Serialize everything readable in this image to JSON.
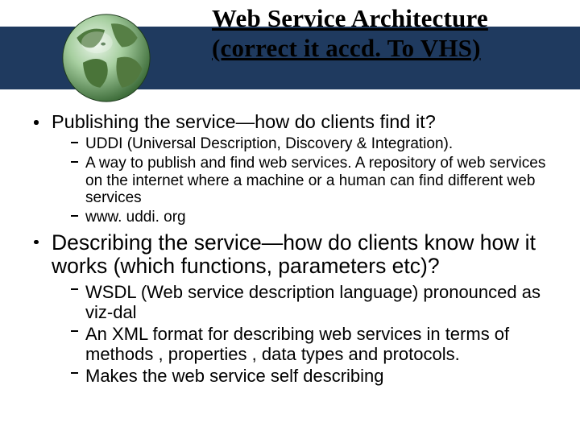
{
  "slide": {
    "title": "Web Service Architecture  (correct it accd. To VHS)",
    "bullets": [
      {
        "text": "Publishing the service—how do clients find it?",
        "size": "med",
        "sub": [
          {
            "text": "UDDI (Universal Description, Discovery & Integration).",
            "size": "sm"
          },
          {
            "text": "A way to publish and find web services. A repository of web services on the internet where a machine or a human can find different web services",
            "size": "sm"
          },
          {
            "text": "www. uddi. org",
            "size": "sm"
          }
        ]
      },
      {
        "text": "Describing the service—how do clients know how it works (which functions, parameters etc)?",
        "size": "large",
        "sub": [
          {
            "text": "WSDL (Web service description language) pronounced as viz-dal",
            "size": "med"
          },
          {
            "text": "An XML format for describing web services in terms of methods , properties , data types and protocols.",
            "size": "med"
          },
          {
            "text": "Makes the web service self describing",
            "size": "med"
          }
        ]
      }
    ]
  }
}
